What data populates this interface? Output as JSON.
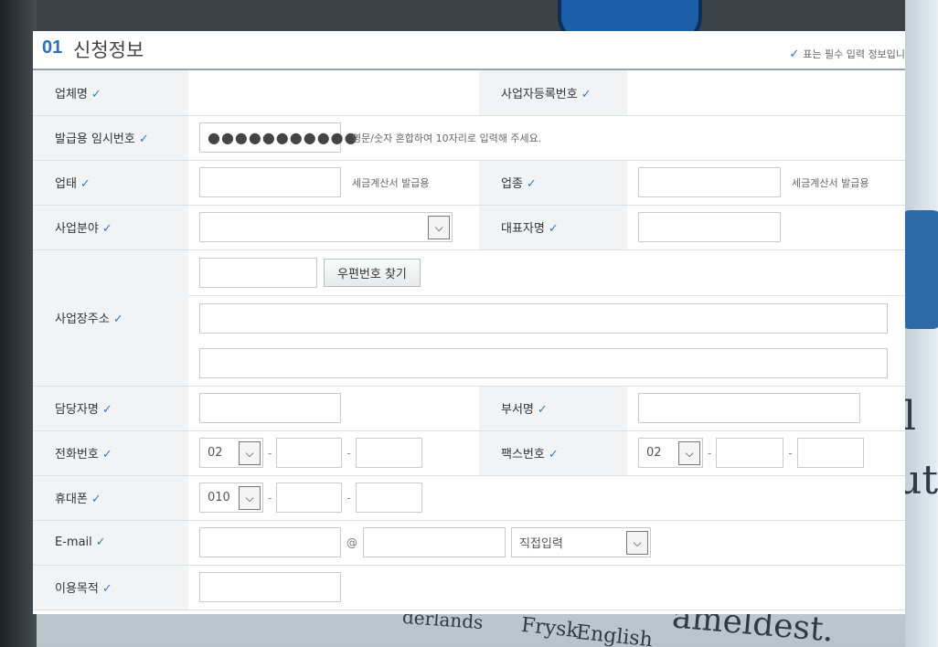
{
  "header": {
    "num": "01",
    "title": "신청정보",
    "note_check": "✓",
    "note": "표는 필수 입력 정보입니"
  },
  "check": "✓",
  "fields": {
    "company_name": "업체명",
    "biz_reg_no": "사업자등록번호",
    "temp_password": "발급용 임시번호",
    "temp_password_value": "●●●●●●●●●●●",
    "temp_password_hint": "영문/숫자 혼합하여 10자리로 입력해 주세요.",
    "biz_type": "업태",
    "biz_type_hint": "세금계산서 발급용",
    "biz_item": "업종",
    "biz_item_hint": "세금계산서 발급용",
    "biz_field": "사업분야",
    "ceo_name": "대표자명",
    "address": "사업장주소",
    "zip_button": "우편번호 찾기",
    "manager": "담당자명",
    "department": "부서명",
    "phone": "전화번호",
    "phone_area": "02",
    "fax": "팩스번호",
    "fax_area": "02",
    "mobile": "휴대폰",
    "mobile_prefix": "010",
    "email": "E-mail",
    "email_at": "@",
    "email_domain_select": "직접입력",
    "purpose": "이용목적",
    "dash": "-"
  },
  "background_text": {
    "t1": "derlands",
    "t2": "Frysk",
    "t3": "English",
    "t4": "ameldest.",
    "t5": "l",
    "t6": "ut"
  }
}
